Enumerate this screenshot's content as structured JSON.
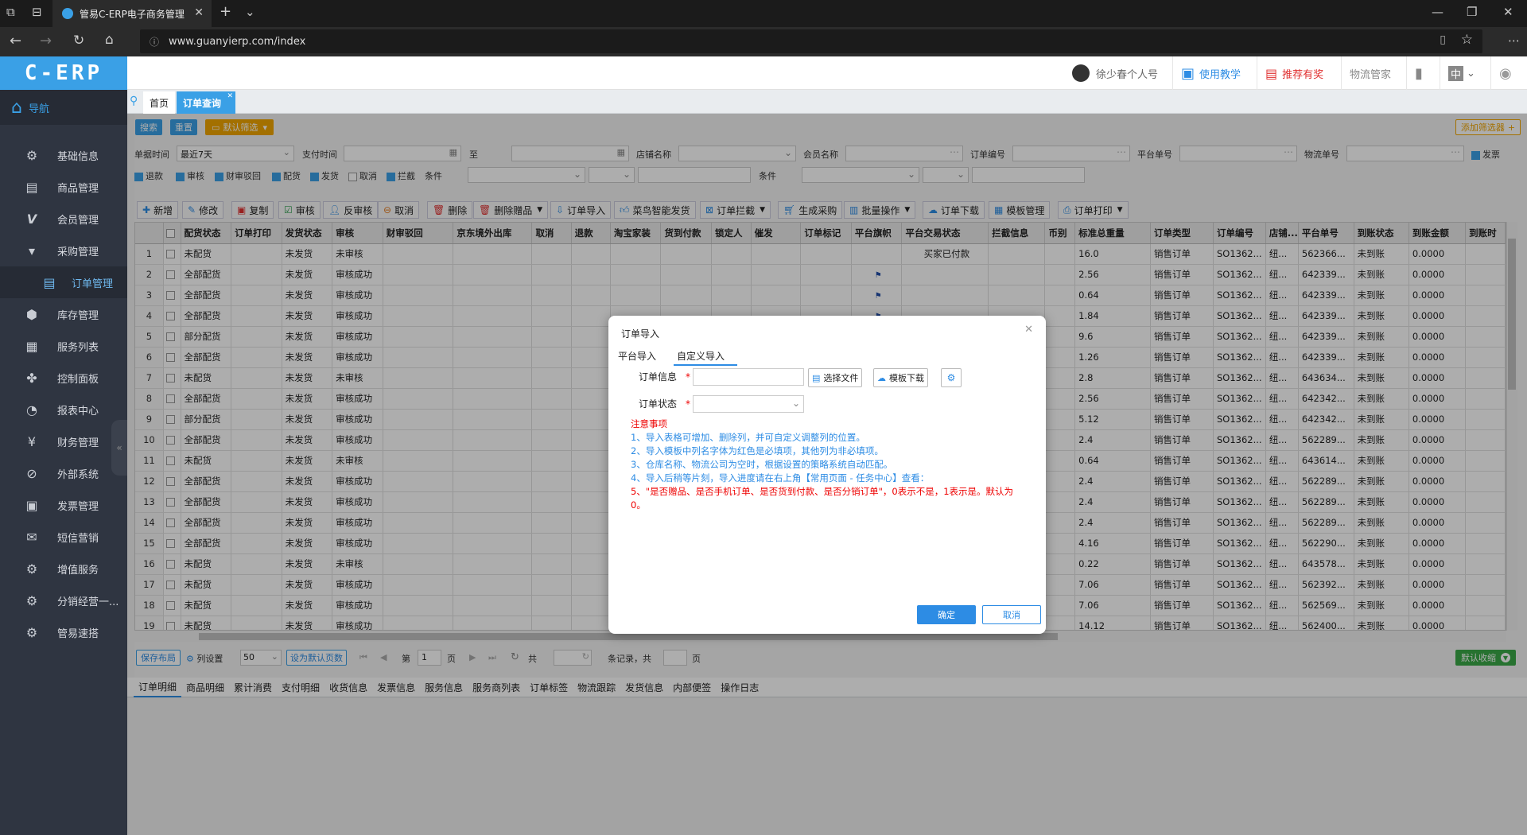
{
  "browser": {
    "tab_title": "管易C-ERP电子商务管理",
    "url": "www.guanyierp.com/index"
  },
  "brand": "C-ERP",
  "nav": {
    "title": "导航",
    "items": [
      {
        "label": "基础信息",
        "icon": "gear-icon"
      },
      {
        "label": "商品管理",
        "icon": "store-icon"
      },
      {
        "label": "会员管理",
        "icon": "v-icon"
      },
      {
        "label": "采购管理",
        "icon": "cart-icon"
      },
      {
        "label": "订单管理",
        "icon": "document-icon"
      },
      {
        "label": "库存管理",
        "icon": "box-icon"
      },
      {
        "label": "服务列表",
        "icon": "list-icon"
      },
      {
        "label": "控制面板",
        "icon": "dashboard-icon"
      },
      {
        "label": "报表中心",
        "icon": "pie-icon"
      },
      {
        "label": "财务管理",
        "icon": "yen-icon"
      },
      {
        "label": "外部系统",
        "icon": "link-icon"
      },
      {
        "label": "发票管理",
        "icon": "invoice-icon"
      },
      {
        "label": "短信营销",
        "icon": "mail-icon"
      },
      {
        "label": "增值服务",
        "icon": "gear-icon"
      },
      {
        "label": "分销经营一...",
        "icon": "gear-icon"
      },
      {
        "label": "管易速搭",
        "icon": "gear-icon"
      }
    ]
  },
  "topbar": {
    "user": "徐少春个人号",
    "tutorial": "使用教学",
    "recommend": "推荐有奖",
    "logistics": "物流管家",
    "lang": "中"
  },
  "page_tabs": {
    "home": "首页",
    "active": "订单查询"
  },
  "filter": {
    "search_btn": "搜索",
    "reset_btn": "重置",
    "default_filter": "默认筛选",
    "add_filter": "添加筛选器",
    "doc_time_label": "单据时间",
    "doc_time_value": "最近7天",
    "pay_time_label": "支付时间",
    "to_label": "至",
    "shop_label": "店铺名称",
    "member_label": "会员名称",
    "order_no_label": "订单编号",
    "platform_no_label": "平台单号",
    "logistics_no_label": "物流单号",
    "shipped_label": "发票",
    "checks": [
      "退款",
      "审核",
      "财审驳回",
      "配货",
      "发货",
      "取消",
      "拦截"
    ],
    "condition_label": "条件",
    "condition2_label": "条件"
  },
  "toolbar": [
    "新增",
    "修改",
    "复制",
    "审核",
    "反审核",
    "取消",
    "删除",
    "删除赠品",
    "订单导入",
    "菜鸟智能发货",
    "订单拦截",
    "生成采购",
    "批量操作",
    "订单下载",
    "模板管理",
    "订单打印"
  ],
  "grid": {
    "headers": [
      "",
      "",
      "配货状态",
      "订单打印",
      "发货状态",
      "审核",
      "财审驳回",
      "京东境外出库",
      "取消",
      "退款",
      "淘宝家装",
      "货到付款",
      "锁定人",
      "催发",
      "订单标记",
      "平台旗帜",
      "平台交易状态",
      "拦截信息",
      "币别",
      "标准总重量",
      "订单类型",
      "订单编号",
      "店铺...",
      "平台单号",
      "到账状态",
      "到账金额",
      "到账时"
    ],
    "rows": [
      {
        "n": "1",
        "pick": "未配货",
        "ship": "未发货",
        "audit": "未审核",
        "flag": "",
        "trade": "买家已付款",
        "weight": "16.0",
        "type": "销售订单",
        "no": "SO1362...",
        "shop": "纽...",
        "pno": "562366...",
        "arrive": "未到账",
        "amt": "0.0000"
      },
      {
        "n": "2",
        "pick": "全部配货",
        "ship": "未发货",
        "audit": "审核成功",
        "flag": "y",
        "trade": "",
        "weight": "2.56",
        "type": "销售订单",
        "no": "SO1362...",
        "shop": "纽...",
        "pno": "642339...",
        "arrive": "未到账",
        "amt": "0.0000"
      },
      {
        "n": "3",
        "pick": "全部配货",
        "ship": "未发货",
        "audit": "审核成功",
        "flag": "y",
        "trade": "",
        "weight": "0.64",
        "type": "销售订单",
        "no": "SO1362...",
        "shop": "纽...",
        "pno": "642339...",
        "arrive": "未到账",
        "amt": "0.0000"
      },
      {
        "n": "4",
        "pick": "全部配货",
        "ship": "未发货",
        "audit": "审核成功",
        "flag": "y",
        "trade": "",
        "weight": "1.84",
        "type": "销售订单",
        "no": "SO1362...",
        "shop": "纽...",
        "pno": "642339...",
        "arrive": "未到账",
        "amt": "0.0000"
      },
      {
        "n": "5",
        "pick": "部分配货",
        "ship": "未发货",
        "audit": "审核成功",
        "flag": "",
        "trade": "",
        "weight": "9.6",
        "type": "销售订单",
        "no": "SO1362...",
        "shop": "纽...",
        "pno": "642339...",
        "arrive": "未到账",
        "amt": "0.0000"
      },
      {
        "n": "6",
        "pick": "全部配货",
        "ship": "未发货",
        "audit": "审核成功",
        "flag": "",
        "trade": "",
        "weight": "1.26",
        "type": "销售订单",
        "no": "SO1362...",
        "shop": "纽...",
        "pno": "642339...",
        "arrive": "未到账",
        "amt": "0.0000"
      },
      {
        "n": "7",
        "pick": "未配货",
        "ship": "未发货",
        "audit": "未审核",
        "flag": "",
        "trade": "",
        "weight": "2.8",
        "type": "销售订单",
        "no": "SO1362...",
        "shop": "纽...",
        "pno": "643634...",
        "arrive": "未到账",
        "amt": "0.0000"
      },
      {
        "n": "8",
        "pick": "全部配货",
        "ship": "未发货",
        "audit": "审核成功",
        "flag": "",
        "trade": "",
        "weight": "2.56",
        "type": "销售订单",
        "no": "SO1362...",
        "shop": "纽...",
        "pno": "642342...",
        "arrive": "未到账",
        "amt": "0.0000"
      },
      {
        "n": "9",
        "pick": "部分配货",
        "ship": "未发货",
        "audit": "审核成功",
        "flag": "",
        "trade": "",
        "weight": "5.12",
        "type": "销售订单",
        "no": "SO1362...",
        "shop": "纽...",
        "pno": "642342...",
        "arrive": "未到账",
        "amt": "0.0000"
      },
      {
        "n": "10",
        "pick": "全部配货",
        "ship": "未发货",
        "audit": "审核成功",
        "flag": "",
        "trade": "",
        "weight": "2.4",
        "type": "销售订单",
        "no": "SO1362...",
        "shop": "纽...",
        "pno": "562289...",
        "arrive": "未到账",
        "amt": "0.0000"
      },
      {
        "n": "11",
        "pick": "未配货",
        "ship": "未发货",
        "audit": "未审核",
        "flag": "",
        "trade": "",
        "weight": "0.64",
        "type": "销售订单",
        "no": "SO1362...",
        "shop": "纽...",
        "pno": "643614...",
        "arrive": "未到账",
        "amt": "0.0000"
      },
      {
        "n": "12",
        "pick": "全部配货",
        "ship": "未发货",
        "audit": "审核成功",
        "flag": "",
        "trade": "",
        "weight": "2.4",
        "type": "销售订单",
        "no": "SO1362...",
        "shop": "纽...",
        "pno": "562289...",
        "arrive": "未到账",
        "amt": "0.0000"
      },
      {
        "n": "13",
        "pick": "全部配货",
        "ship": "未发货",
        "audit": "审核成功",
        "flag": "",
        "trade": "",
        "weight": "2.4",
        "type": "销售订单",
        "no": "SO1362...",
        "shop": "纽...",
        "pno": "562289...",
        "arrive": "未到账",
        "amt": "0.0000"
      },
      {
        "n": "14",
        "pick": "全部配货",
        "ship": "未发货",
        "audit": "审核成功",
        "flag": "",
        "trade": "",
        "weight": "2.4",
        "type": "销售订单",
        "no": "SO1362...",
        "shop": "纽...",
        "pno": "562289...",
        "arrive": "未到账",
        "amt": "0.0000"
      },
      {
        "n": "15",
        "pick": "全部配货",
        "ship": "未发货",
        "audit": "审核成功",
        "flag": "",
        "trade": "",
        "weight": "4.16",
        "type": "销售订单",
        "no": "SO1362...",
        "shop": "纽...",
        "pno": "562290...",
        "arrive": "未到账",
        "amt": "0.0000"
      },
      {
        "n": "16",
        "pick": "未配货",
        "ship": "未发货",
        "audit": "未审核",
        "flag": "",
        "trade": "",
        "weight": "0.22",
        "type": "销售订单",
        "no": "SO1362...",
        "shop": "纽...",
        "pno": "643578...",
        "arrive": "未到账",
        "amt": "0.0000"
      },
      {
        "n": "17",
        "pick": "未配货",
        "ship": "未发货",
        "audit": "审核成功",
        "flag": "",
        "trade": "",
        "weight": "7.06",
        "type": "销售订单",
        "no": "SO1362...",
        "shop": "纽...",
        "pno": "562392...",
        "arrive": "未到账",
        "amt": "0.0000"
      },
      {
        "n": "18",
        "pick": "未配货",
        "ship": "未发货",
        "audit": "审核成功",
        "flag": "",
        "trade": "",
        "weight": "7.06",
        "type": "销售订单",
        "no": "SO1362...",
        "shop": "纽...",
        "pno": "562569...",
        "arrive": "未到账",
        "amt": "0.0000"
      },
      {
        "n": "19",
        "pick": "未配货",
        "ship": "未发货",
        "audit": "审核成功",
        "flag": "",
        "trade": "",
        "weight": "14.12",
        "type": "销售订单",
        "no": "SO1362...",
        "shop": "纽...",
        "pno": "562400...",
        "arrive": "未到账",
        "amt": "0.0000"
      }
    ]
  },
  "pager": {
    "save_layout": "保存布局",
    "col_settings": "列设置",
    "page_size": "50",
    "set_default": "设为默认页数",
    "page_label": "第",
    "page_value": "1",
    "page_unit": "页",
    "total_label": "共",
    "records_label": "条记录，共",
    "pages_unit": "页",
    "default_collapse": "默认收缩"
  },
  "bottom_tabs": [
    "订单明细",
    "商品明细",
    "累计消费",
    "支付明细",
    "收货信息",
    "发票信息",
    "服务信息",
    "服务商列表",
    "订单标签",
    "物流跟踪",
    "发货信息",
    "内部便签",
    "操作日志"
  ],
  "modal": {
    "title": "订单导入",
    "tab_platform": "平台导入",
    "tab_custom": "自定义导入",
    "order_info_label": "订单信息",
    "order_status_label": "订单状态",
    "required_mark": "*",
    "choose_file": "选择文件",
    "template_download": "模板下载",
    "notes_title": "注意事项",
    "note1": "1、导入表格可增加、删除列，并可自定义调整列的位置。",
    "note2": "2、导入模板中列名字体为红色是必填项，其他列为非必填项。",
    "note3": "3、仓库名称、物流公司为空时，根据设置的策略系统自动匹配。",
    "note4": "4、导入后稍等片刻，导入进度请在右上角【常用页面 - 任务中心】查看：",
    "note5": "5、\"是否赠品、是否手机订单、是否货到付款、是否分销订单\"，0表示不是，1表示是。默认为0。",
    "ok": "确定",
    "cancel": "取消"
  }
}
